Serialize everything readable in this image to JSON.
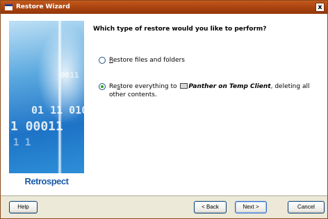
{
  "window": {
    "title": "Restore Wizard",
    "close_label": "x"
  },
  "side_panel": {
    "digits": [
      "0011",
      "01 11 010",
      "1 00011",
      "1 1"
    ],
    "brand": "Retrospect"
  },
  "wizard": {
    "question": "Which type of restore would you like to perform?",
    "options": [
      {
        "access_key": "R",
        "label_rest": "estore files and folders",
        "selected": false
      },
      {
        "prefix_before_key": "Re",
        "access_key": "s",
        "label_rest": "tore everything to ",
        "client_name": "Panther on Temp Client",
        "suffix": ", deleting all other contents.",
        "selected": true
      }
    ]
  },
  "buttons": {
    "help": "Help",
    "back": "< Back",
    "next": "Next >",
    "cancel": "Cancel"
  },
  "colors": {
    "titlebar": "#a8420f",
    "selected_radio": "#21a121",
    "brand": "#1b5aa8"
  }
}
